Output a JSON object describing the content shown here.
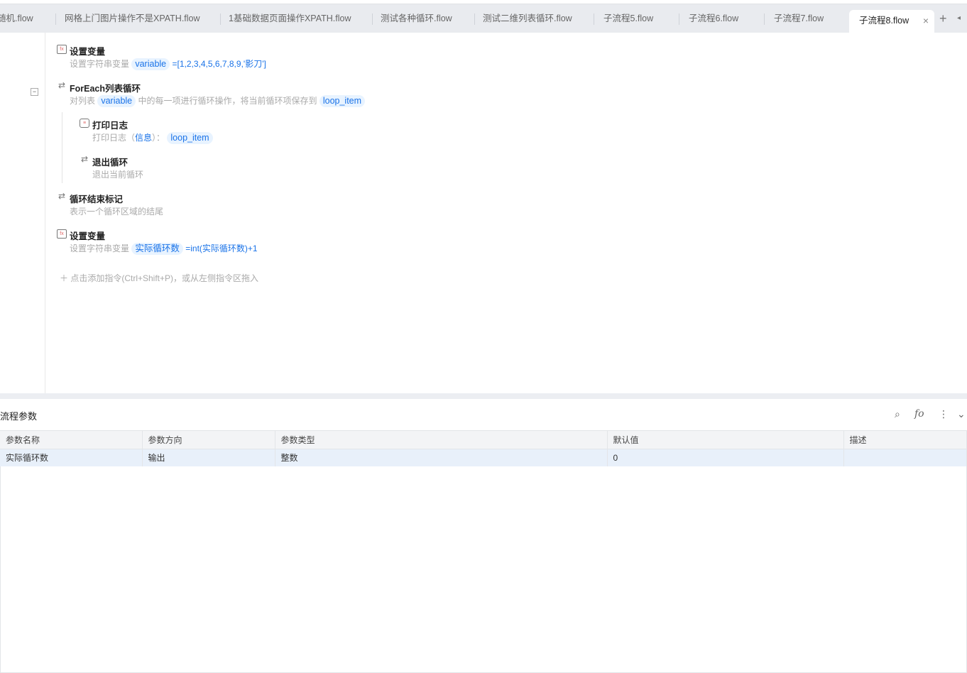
{
  "tabs": [
    {
      "label": "随机.flow"
    },
    {
      "label": "网格上门图片操作不是XPATH.flow"
    },
    {
      "label": "1基础数据页面操作XPATH.flow"
    },
    {
      "label": "测试各种循环.flow"
    },
    {
      "label": "测试二维列表循环.flow"
    },
    {
      "label": "子流程5.flow"
    },
    {
      "label": "子流程6.flow"
    },
    {
      "label": "子流程7.flow"
    },
    {
      "label": "子流程8.flow",
      "active": true
    }
  ],
  "tab_close": "×",
  "tab_add": "+",
  "tab_scroll": "◂",
  "steps": [
    {
      "title": "设置变量",
      "desc_prefix": "设置字符串变量",
      "var": "variable",
      "value": "=[1,2,3,4,5,6,7,8,9,'影刀']"
    },
    {
      "title": "ForEach列表循环",
      "desc_prefix": "对列表",
      "var": "variable",
      "desc_mid": "中的每一项进行循环操作，将当前循环项保存到",
      "var2": "loop_item"
    },
    {
      "title": "打印日志",
      "desc_prefix": "打印日志（",
      "level": "信息",
      "desc_mid": "）：",
      "var": "loop_item"
    },
    {
      "title": "退出循环",
      "desc": "退出当前循环"
    },
    {
      "title": "循环结束标记",
      "desc": "表示一个循环区域的结尾"
    },
    {
      "title": "设置变量",
      "desc_prefix": "设置字符串变量",
      "var": "实际循环数",
      "value": "=int(实际循环数)+1"
    }
  ],
  "collapse_symbol": "−",
  "add_hint": "＋  点击添加指令(Ctrl+Shift+P)，或从左侧指令区拖入",
  "panel": {
    "title": "流程参数",
    "columns": [
      "参数名称",
      "参数方向",
      "参数类型",
      "默认值",
      "描述"
    ],
    "rows": [
      [
        "实际循环数",
        "输出",
        "整数",
        "0",
        ""
      ]
    ]
  }
}
